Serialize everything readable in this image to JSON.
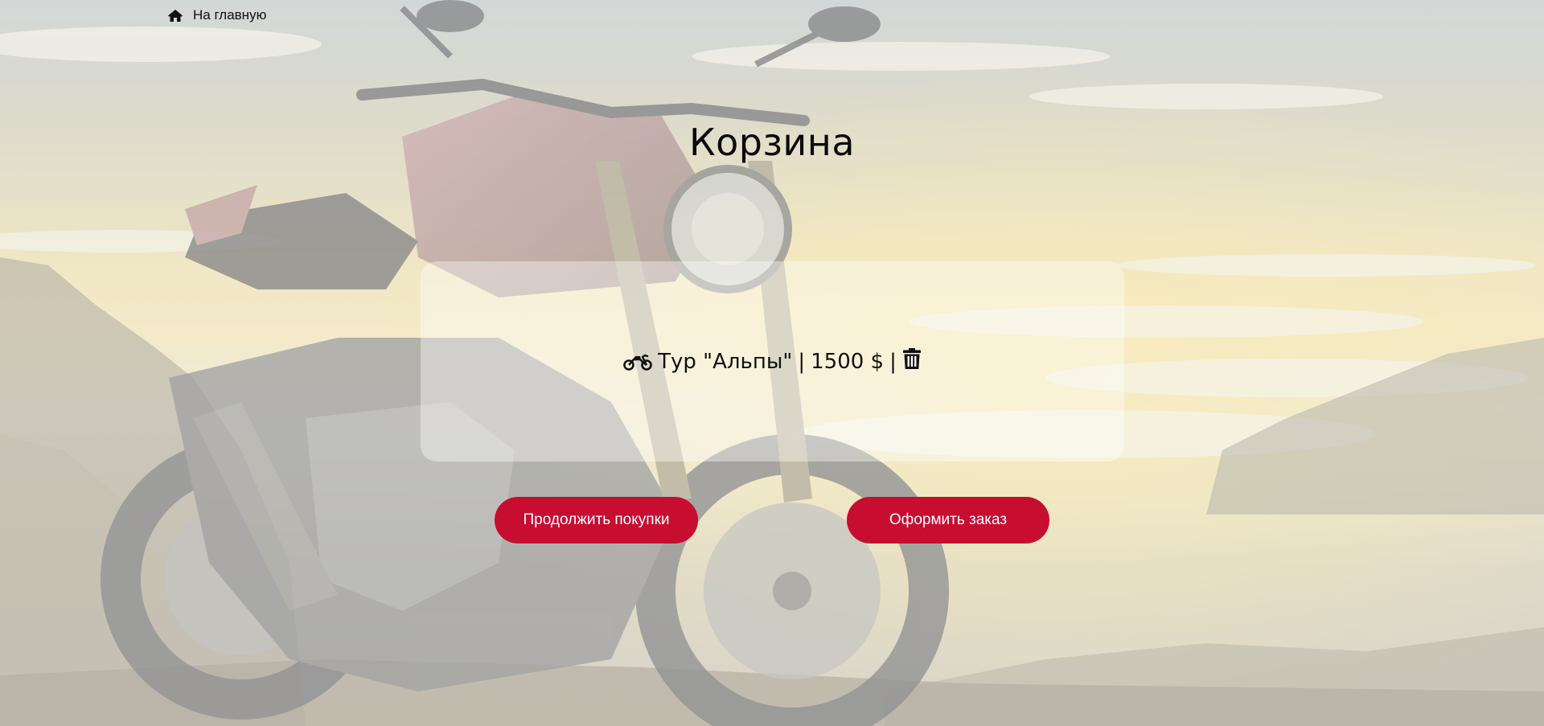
{
  "nav": {
    "home_label": "На главную",
    "home_icon": "home-icon"
  },
  "cart": {
    "title": "Корзина",
    "items": [
      {
        "icon": "motorcycle-icon",
        "name": "Тур \"Альпы\"",
        "separator": "|",
        "price": "1500 $",
        "delete_icon": "trash-icon"
      }
    ]
  },
  "actions": {
    "continue_label": "Продолжить покупки",
    "checkout_label": "Оформить заказ"
  },
  "colors": {
    "accent": "#c70d30",
    "panel": "rgba(255,255,255,0.38)",
    "text": "#111111"
  }
}
